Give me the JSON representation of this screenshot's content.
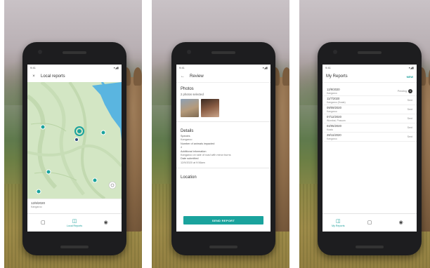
{
  "colors": {
    "accent": "#1aa39d",
    "map_land": "#d3e6c4",
    "map_water": "#5ab5e0"
  },
  "screen1": {
    "status_time": "9:41",
    "status_icons": "▾◢▮",
    "close_icon": "×",
    "title": "Local reports",
    "report_date": "12/9/2020",
    "report_species": "Kangaroo",
    "nav": [
      {
        "icon": "▢",
        "label": ""
      },
      {
        "icon": "◫",
        "label": "Local Reports"
      },
      {
        "icon": "◉",
        "label": ""
      }
    ]
  },
  "screen2": {
    "status_time": "9:41",
    "status_icons": "▾◢▮",
    "back_icon": "←",
    "title": "Review",
    "photos_heading": "Photos",
    "photos_sub": "2 photos selected",
    "details_heading": "Details",
    "detail_lines": [
      "Species",
      "Kangaroo",
      "Number of animals impacted",
      "4",
      "Additional information",
      "Kangaroo on side of road with minor burns",
      "Date submitted",
      "12/9/2020 at 9:56am"
    ],
    "location_heading": "Location",
    "send_button": "SEND REPORT"
  },
  "screen3": {
    "status_time": "9:41",
    "status_icons": "▾◢▮",
    "title": "My Reports",
    "new_action": "NEW",
    "pending_label": "Pending",
    "pending_count": "1",
    "reports": [
      {
        "date": "12/9/2020",
        "species": "Kangaroo",
        "status": "pending"
      },
      {
        "date": "11/7/2020",
        "species": "Kangaroo (Koala)",
        "status": "Sent"
      },
      {
        "date": "09/09/2020",
        "species": "Kangaroo",
        "status": "Sent"
      },
      {
        "date": "07/12/2020",
        "species": "Wombat, Possum",
        "status": "Sent"
      },
      {
        "date": "04/05/2020",
        "species": "Koala",
        "status": "Sent"
      },
      {
        "date": "28/11/2020",
        "species": "Kangaroo",
        "status": "Sent"
      }
    ],
    "nav": [
      {
        "icon": "◫",
        "label": "My Reports"
      },
      {
        "icon": "▢",
        "label": ""
      },
      {
        "icon": "◉",
        "label": ""
      }
    ]
  }
}
